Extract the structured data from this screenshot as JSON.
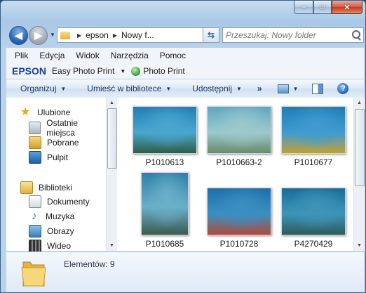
{
  "window": {
    "caption": {
      "minimize": "–",
      "maximize": "□",
      "close": "✕"
    }
  },
  "address": {
    "segments": [
      "epson",
      "Nowy f..."
    ]
  },
  "search": {
    "placeholder": "Przeszukaj: Nowy folder"
  },
  "menu": [
    "Plik",
    "Edycja",
    "Widok",
    "Narzędzia",
    "Pomoc"
  ],
  "epson": {
    "logo": "EPSON",
    "app": "Easy Photo Print",
    "print": "Photo Print"
  },
  "toolbar": {
    "organize": "Organizuj",
    "library": "Umieść w bibliotece",
    "share": "Udostępnij",
    "more": "»"
  },
  "nav": {
    "favorites": {
      "label": "Ulubione",
      "items": [
        "Ostatnie miejsca",
        "Pobrane",
        "Pulpit"
      ]
    },
    "libraries": {
      "label": "Biblioteki",
      "items": [
        "Dokumenty",
        "Muzyka",
        "Obrazy",
        "Wideo"
      ]
    }
  },
  "files": [
    {
      "name": "P1010613",
      "colors": [
        "#1f7fb3",
        "#4aa6cf",
        "#2e5d44"
      ]
    },
    {
      "name": "P1010663-2",
      "colors": [
        "#5fa6bf",
        "#9bc9cc",
        "#6b8a6e"
      ]
    },
    {
      "name": "P1010677",
      "colors": [
        "#1e7db8",
        "#3f9bd0",
        "#c0a03a"
      ]
    },
    {
      "name": "P1010685",
      "colors": [
        "#2d7fa8",
        "#69b0c9",
        "#3b5a4e"
      ]
    },
    {
      "name": "P1010728",
      "colors": [
        "#1d6fa8",
        "#3a8fc2",
        "#b04a3a"
      ]
    },
    {
      "name": "P4270429",
      "colors": [
        "#1a6b98",
        "#3d95b8",
        "#2e5a5a"
      ]
    }
  ],
  "details": {
    "count_label": "Elementów: 9"
  }
}
